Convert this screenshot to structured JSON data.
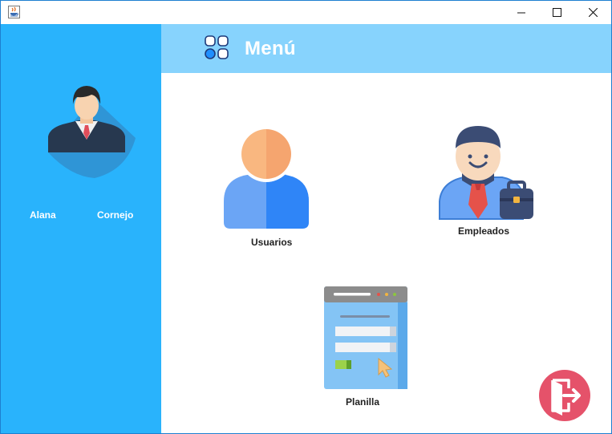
{
  "window": {
    "title": "",
    "controls": {
      "minimize": "minimize-icon",
      "maximize": "maximize-icon",
      "close": "close-icon"
    }
  },
  "sidebar": {
    "background": "#29b3fc",
    "avatar_icon": "businessman-avatar-icon",
    "first_name": "Alana",
    "last_name": "Cornejo"
  },
  "header": {
    "background": "#87d3fd",
    "icon": "menu-grid-icon",
    "title": "Menú"
  },
  "menu": {
    "items": [
      {
        "label": "Usuarios",
        "icon": "user-icon"
      },
      {
        "label": "Empleados",
        "icon": "employee-icon"
      },
      {
        "label": "Planilla",
        "icon": "payroll-form-icon"
      }
    ]
  },
  "exit": {
    "icon": "exit-door-icon",
    "color": "#e5526a"
  }
}
